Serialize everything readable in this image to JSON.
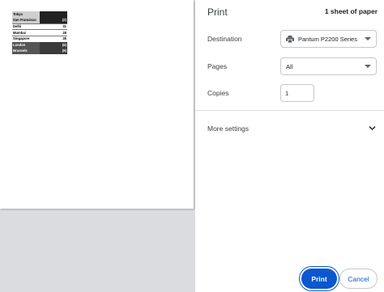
{
  "dialog": {
    "title": "Print",
    "sheet_count": "1 sheet of paper"
  },
  "destination": {
    "label": "Destination",
    "value": "Pantum P2200 Series"
  },
  "pages": {
    "label": "Pages",
    "value": "All"
  },
  "copies": {
    "label": "Copies",
    "value": "1"
  },
  "more_settings": {
    "label": "More settings"
  },
  "buttons": {
    "print": "Print",
    "cancel": "Cancel"
  },
  "preview_table": {
    "rows": [
      {
        "name": "Tokyo",
        "value": "",
        "style": "grey"
      },
      {
        "name": "San Francisco",
        "value": "(2)",
        "style": "grey"
      },
      {
        "name": "Delhi",
        "value": "31",
        "style": "light"
      },
      {
        "name": "Mumbai",
        "value": "28",
        "style": "light"
      },
      {
        "name": "Singapore",
        "value": "35",
        "style": "light"
      },
      {
        "name": "London",
        "value": "(6)",
        "style": "dark"
      },
      {
        "name": "Brussels",
        "value": "(8)",
        "style": "dark"
      }
    ]
  },
  "colors": {
    "accent": "#0b57d0",
    "preview_background": "#dadce0"
  }
}
